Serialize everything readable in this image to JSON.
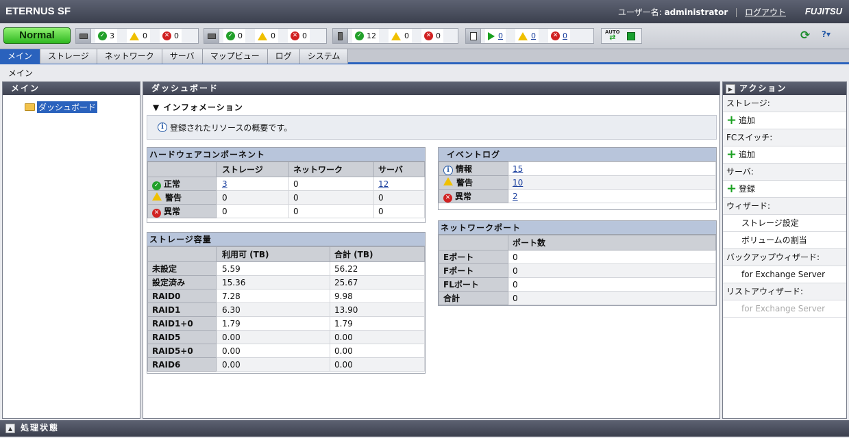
{
  "header": {
    "app_title": "ETERNUS SF",
    "user_label": "ユーザー名:",
    "username": "administrator",
    "logout": "ログアウト",
    "brand": "FUJITSU"
  },
  "status": {
    "overall": "Normal",
    "storage": {
      "ok": "3",
      "warn": "0",
      "error": "0"
    },
    "network": {
      "ok": "0",
      "warn": "0",
      "error": "0"
    },
    "server": {
      "ok": "12",
      "warn": "0",
      "error": "0"
    },
    "jobs": {
      "running": "0",
      "warn": "0",
      "error": "0"
    },
    "auto_label": "AUTO",
    "help_symbol": "?▾",
    "refresh_symbol": "⟳"
  },
  "tabs": [
    "メイン",
    "ストレージ",
    "ネットワーク",
    "サーバ",
    "マップビュー",
    "ログ",
    "システム"
  ],
  "breadcrumb": "メイン",
  "left_panel": {
    "title": "メイン",
    "tree_item": "ダッシュボード"
  },
  "main_panel": {
    "title": "ダッシュボード",
    "info_section": "▼ インフォメーション",
    "info_text": "登録されたリソースの概要です。"
  },
  "hardware": {
    "title": "ハードウェアコンポーネント",
    "columns": [
      "",
      "ストレージ",
      "ネットワーク",
      "サーバ"
    ],
    "rows": [
      {
        "label": "正常",
        "storage": "3",
        "network": "0",
        "server": "12"
      },
      {
        "label": "警告",
        "storage": "0",
        "network": "0",
        "server": "0"
      },
      {
        "label": "異常",
        "storage": "0",
        "network": "0",
        "server": "0"
      }
    ]
  },
  "event_log": {
    "title": "イベントログ",
    "rows": [
      {
        "label": "情報",
        "value": "15"
      },
      {
        "label": "警告",
        "value": "10"
      },
      {
        "label": "異常",
        "value": "2"
      }
    ]
  },
  "storage_capacity": {
    "title": "ストレージ容量",
    "columns": [
      "",
      "利用可 (TB)",
      "合計 (TB)"
    ],
    "rows": [
      {
        "label": "未設定",
        "available": "5.59",
        "total": "56.22"
      },
      {
        "label": "設定済み",
        "available": "15.36",
        "total": "25.67"
      },
      {
        "label": "RAID0",
        "available": "7.28",
        "total": "9.98"
      },
      {
        "label": "RAID1",
        "available": "6.30",
        "total": "13.90"
      },
      {
        "label": "RAID1+0",
        "available": "1.79",
        "total": "1.79"
      },
      {
        "label": "RAID5",
        "available": "0.00",
        "total": "0.00"
      },
      {
        "label": "RAID5+0",
        "available": "0.00",
        "total": "0.00"
      },
      {
        "label": "RAID6",
        "available": "0.00",
        "total": "0.00"
      }
    ]
  },
  "network_port": {
    "title": "ネットワークポート",
    "columns": [
      "",
      "ポート数"
    ],
    "rows": [
      {
        "label": "Eポート",
        "value": "0"
      },
      {
        "label": "Fポート",
        "value": "0"
      },
      {
        "label": "FLポート",
        "value": "0"
      },
      {
        "label": "合計",
        "value": "0"
      }
    ]
  },
  "actions": {
    "title": "アクション",
    "storage_section": "ストレージ:",
    "storage_add": "追加",
    "fc_section": "FCスイッチ:",
    "fc_add": "追加",
    "server_section": "サーバ:",
    "server_register": "登録",
    "wizard_section": "ウィザード:",
    "wizard_storage": "ストレージ設定",
    "wizard_volume": "ボリュームの割当",
    "backup_section": "バックアップウィザード:",
    "backup_exchange": "for Exchange Server",
    "restore_section": "リストアウィザード:",
    "restore_exchange": "for Exchange Server"
  },
  "bottom": {
    "title": "処理状態"
  }
}
